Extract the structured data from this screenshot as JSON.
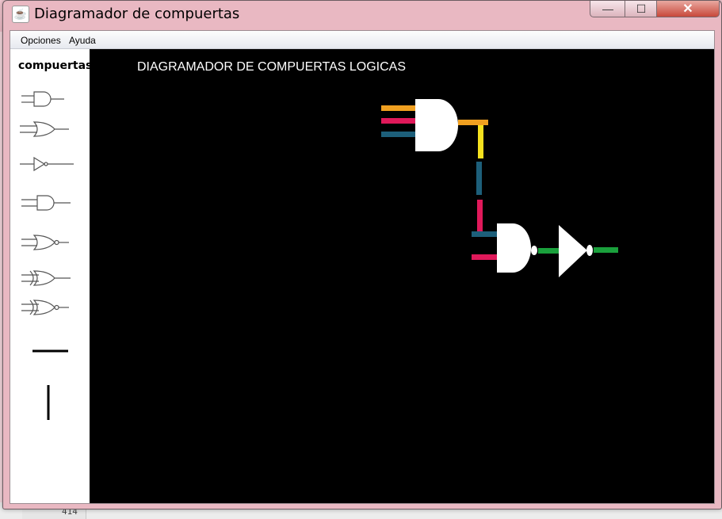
{
  "window": {
    "title": "Diagramador de compuertas",
    "icon": "java-cup-icon",
    "controls": {
      "minimize": "—",
      "maximize": "☐",
      "close": "✕"
    }
  },
  "menu": {
    "items": [
      "Opciones",
      "Ayuda"
    ]
  },
  "sidebar": {
    "title": "compuertas",
    "tools": [
      {
        "name": "and-gate-icon"
      },
      {
        "name": "or-gate-icon"
      },
      {
        "name": "not-gate-icon"
      },
      {
        "name": "and-gate-icon"
      },
      {
        "name": "nor-gate-icon"
      },
      {
        "name": "xor-gate-icon"
      },
      {
        "name": "xnor-gate-icon"
      },
      {
        "name": "horizontal-wire-icon"
      },
      {
        "name": "vertical-wire-icon"
      }
    ]
  },
  "canvas": {
    "title": "DIAGRAMADOR DE COMPUERTAS LOGICAS",
    "background": "#000000",
    "wire_colors": {
      "orange": "#f0a020",
      "pink": "#e0195a",
      "teal": "#1d5f7a",
      "yellow": "#f5e11e",
      "green": "#1aa03c"
    }
  },
  "background": {
    "line_number": "414"
  }
}
